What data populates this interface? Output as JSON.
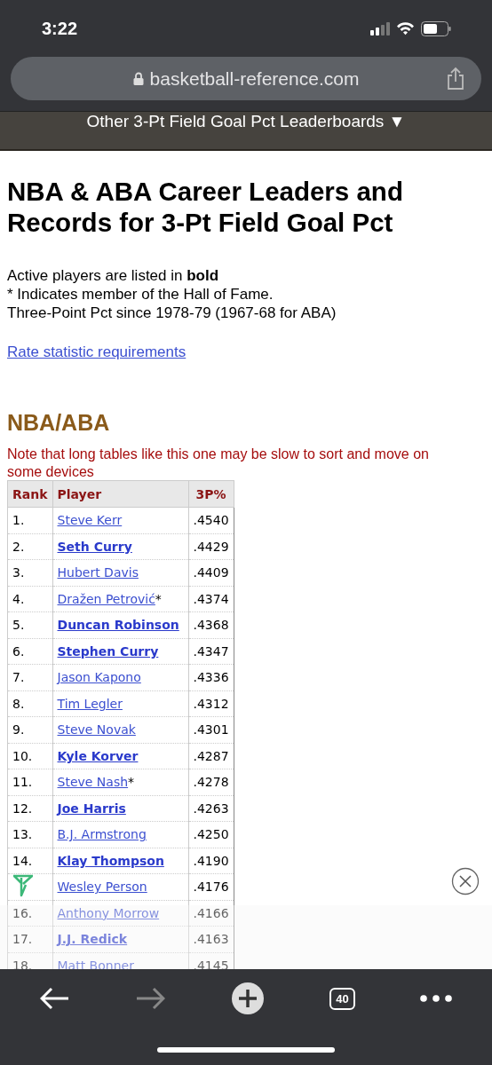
{
  "status_bar": {
    "time": "3:22"
  },
  "address_bar": {
    "url": "basketball-reference.com"
  },
  "leaderboards_menu": {
    "label": "Other 3-Pt Field Goal Pct Leaderboards ▼"
  },
  "title": "NBA & ABA Career Leaders and Records for 3-Pt Field Goal Pct",
  "notes": [
    "Active players are listed in **bold**",
    "* Indicates member of the Hall of Fame.",
    "Three-Point Pct since 1978-79 (1967-68 for ABA)"
  ],
  "requirements_link": "Rate statistic requirements",
  "section_heading": "NBA/ABA",
  "warning": "Note that long tables like this one may be slow to sort and move on some devices",
  "table": {
    "columns": [
      "Rank",
      "Player",
      "3P%"
    ],
    "rows": [
      {
        "rank": "1.",
        "player": "Steve Kerr",
        "active": false,
        "hof": "",
        "pct": ".4540"
      },
      {
        "rank": "2.",
        "player": "Seth Curry",
        "active": true,
        "hof": "",
        "pct": ".4429"
      },
      {
        "rank": "3.",
        "player": "Hubert Davis",
        "active": false,
        "hof": "",
        "pct": ".4409"
      },
      {
        "rank": "4.",
        "player": "Dražen Petrović",
        "active": false,
        "hof": "*",
        "pct": ".4374"
      },
      {
        "rank": "5.",
        "player": "Duncan Robinson",
        "active": true,
        "hof": "",
        "pct": ".4368"
      },
      {
        "rank": "6.",
        "player": "Stephen Curry",
        "active": true,
        "hof": "",
        "pct": ".4347"
      },
      {
        "rank": "7.",
        "player": "Jason Kapono",
        "active": false,
        "hof": "",
        "pct": ".4336"
      },
      {
        "rank": "8.",
        "player": "Tim Legler",
        "active": false,
        "hof": "",
        "pct": ".4312"
      },
      {
        "rank": "9.",
        "player": "Steve Novak",
        "active": false,
        "hof": "",
        "pct": ".4301"
      },
      {
        "rank": "10.",
        "player": "Kyle Korver",
        "active": true,
        "hof": "",
        "pct": ".4287"
      },
      {
        "rank": "11.",
        "player": "Steve Nash",
        "active": false,
        "hof": "*",
        "pct": ".4278"
      },
      {
        "rank": "12.",
        "player": "Joe Harris",
        "active": true,
        "hof": "",
        "pct": ".4263"
      },
      {
        "rank": "13.",
        "player": "B.J. Armstrong",
        "active": false,
        "hof": "",
        "pct": ".4250"
      },
      {
        "rank": "14.",
        "player": "Klay Thompson",
        "active": true,
        "hof": "",
        "pct": ".4190"
      },
      {
        "player": "Wesley Person",
        "active": false,
        "hof": "",
        "pct": ".4176"
      },
      {
        "rank": "16.",
        "player": "Anthony Morrow",
        "active": false,
        "hof": "",
        "pct": ".4166"
      },
      {
        "rank": "17.",
        "player": "J.J. Redick",
        "active": true,
        "hof": "",
        "pct": ".4163"
      },
      {
        "rank": "18.",
        "player": "Matt Bonner",
        "active": false,
        "hof": "",
        "pct": ".4145"
      }
    ]
  },
  "toolbar": {
    "tab_count": "40"
  }
}
